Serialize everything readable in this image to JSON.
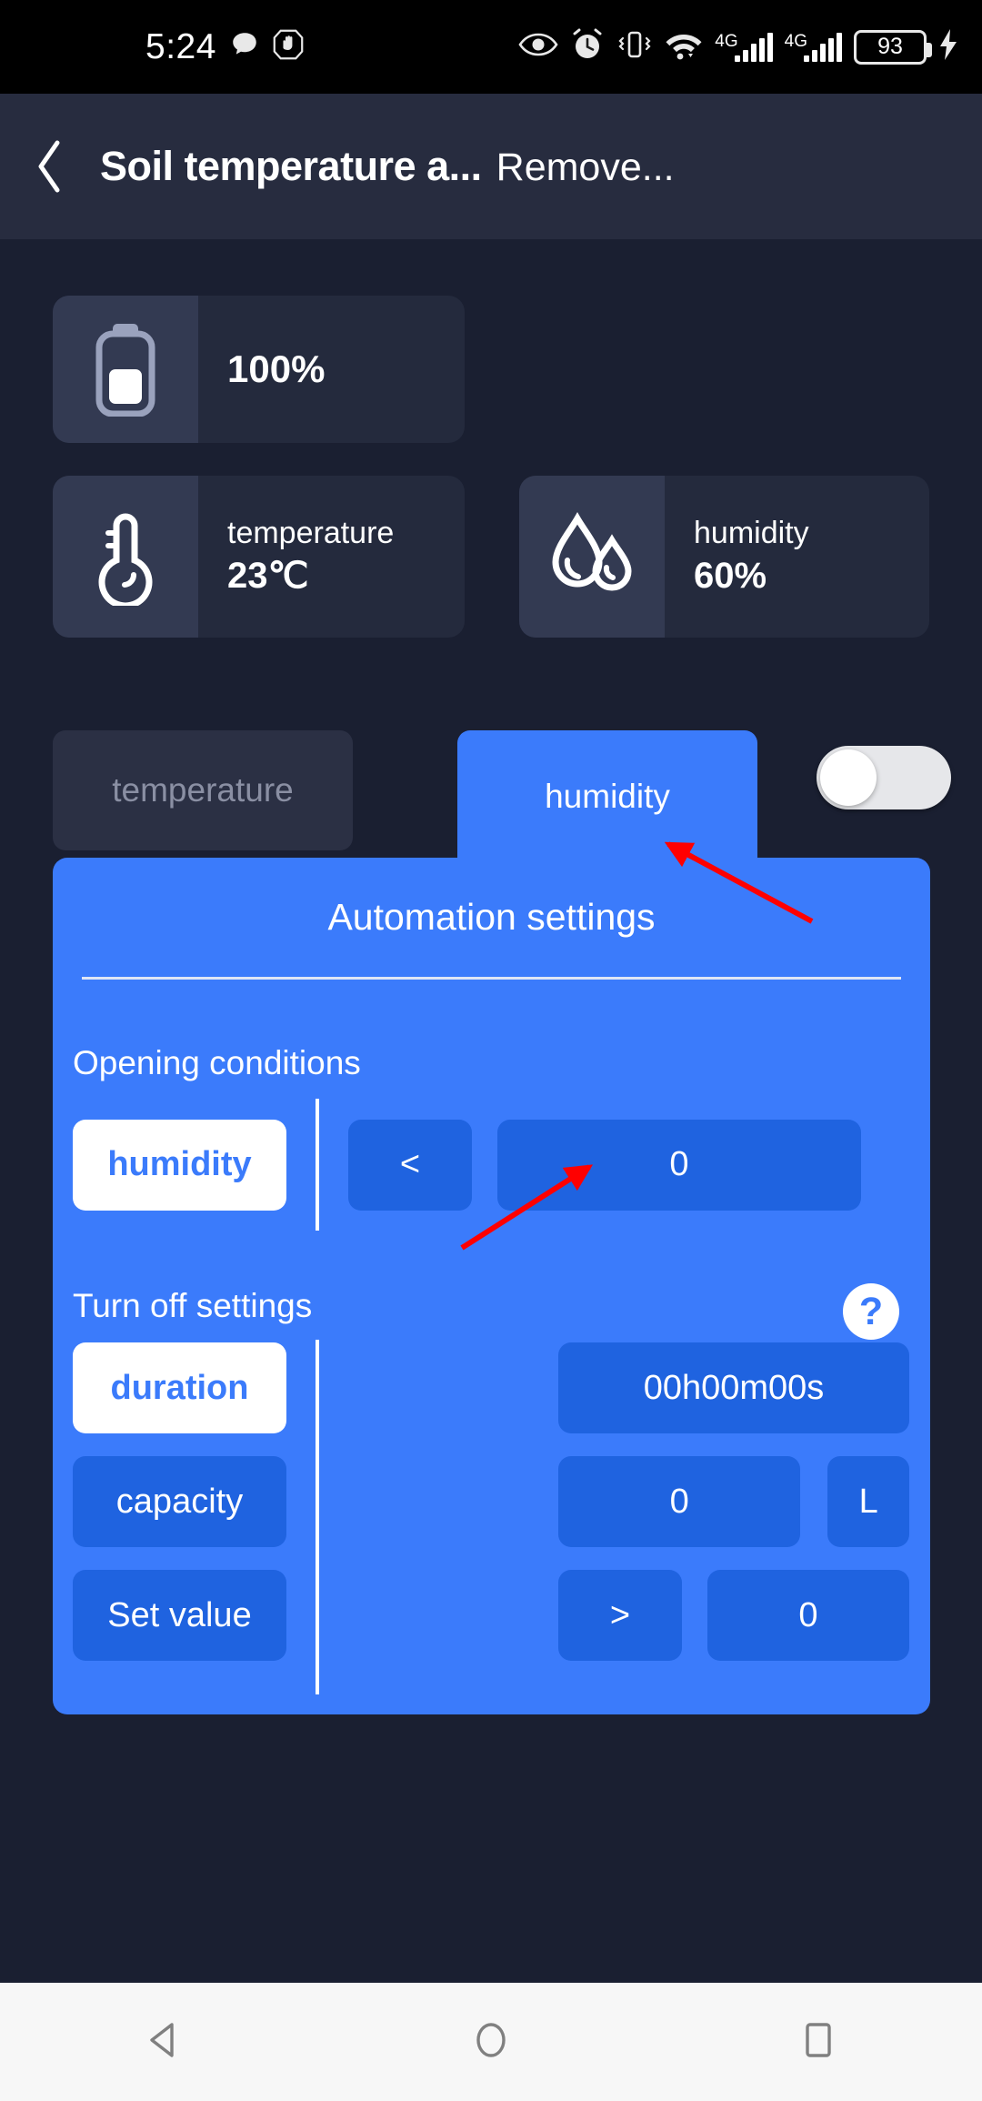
{
  "status_bar": {
    "time": "5:24",
    "battery_percent": "93",
    "network_label_1": "4G",
    "network_label_2": "4G",
    "icons": [
      "message-bubble-icon",
      "hand-do-not-disturb-icon",
      "eye-icon",
      "alarm-clock-icon",
      "vibrate-icon",
      "wifi-icon",
      "signal-bars-icon",
      "signal-bars-icon",
      "battery-icon",
      "charging-bolt-icon"
    ]
  },
  "header": {
    "back_label": "back-chevron",
    "title": "Soil temperature a...",
    "action_label": "Remove..."
  },
  "sensors": {
    "battery": {
      "icon": "battery-icon",
      "value": "100%"
    },
    "temperature": {
      "icon": "thermometer-icon",
      "label": "temperature",
      "value": "23℃"
    },
    "humidity": {
      "icon": "water-drops-icon",
      "label": "humidity",
      "value": "60%"
    }
  },
  "tabs": {
    "inactive_label": "temperature",
    "active_label": "humidity"
  },
  "toggle": {
    "name": "automation-enable-toggle",
    "state": "off"
  },
  "panel": {
    "title": "Automation settings",
    "opening_conditions": {
      "section_label": "Opening conditions",
      "parameter": "humidity",
      "operator": "<",
      "value": "0"
    },
    "turn_off_settings": {
      "section_label": "Turn off settings",
      "help_label": "?",
      "rows": [
        {
          "chip": "duration",
          "selected": true,
          "value": "00h00m00s",
          "unit": "",
          "operator": ""
        },
        {
          "chip": "capacity",
          "selected": false,
          "value": "0",
          "unit": "L",
          "operator": ""
        },
        {
          "chip": "Set value",
          "selected": false,
          "value": "0",
          "unit": "",
          "operator": ">"
        }
      ]
    }
  },
  "nav_bar": {
    "back": "triangle-back-icon",
    "home": "circle-home-icon",
    "recents": "square-recents-icon"
  },
  "colors": {
    "background": "#1a1f31",
    "header_bg": "#272c3f",
    "card_bg": "#242a3d",
    "card_icon_bg": "#333a52",
    "accent_blue": "#3b7bfb",
    "field_blue": "#1f63e0",
    "annotation_red": "#ff0000"
  }
}
